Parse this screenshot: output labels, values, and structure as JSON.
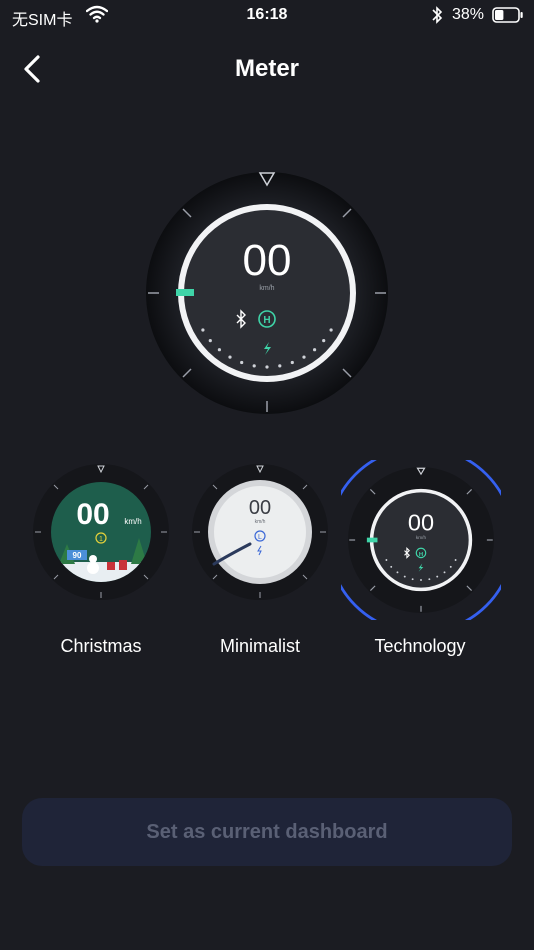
{
  "status": {
    "carrier": "无SIM卡",
    "time": "16:18",
    "battery": "38%",
    "battery_level": 0.38
  },
  "nav": {
    "title": "Meter",
    "back_icon": "chevron-left-icon"
  },
  "preview": {
    "speed": "00",
    "unit": "km/h",
    "mode_badge": "H",
    "accent": "#3fd4a8"
  },
  "themes": [
    {
      "label": "Christmas",
      "speed": "00",
      "unit": "km/h",
      "badge": "1",
      "sign": "90",
      "selected": false
    },
    {
      "label": "Minimalist",
      "speed": "00",
      "unit": "km/h",
      "badge": "L",
      "selected": false
    },
    {
      "label": "Technology",
      "speed": "00",
      "unit": "km/h",
      "badge": "H",
      "selected": true
    }
  ],
  "colors": {
    "background": "#1b1c22",
    "selection_ring": "#3560f0",
    "button_bg": "#1f2438",
    "button_text": "#5a6075"
  },
  "action": {
    "set_label": "Set as current dashboard"
  }
}
